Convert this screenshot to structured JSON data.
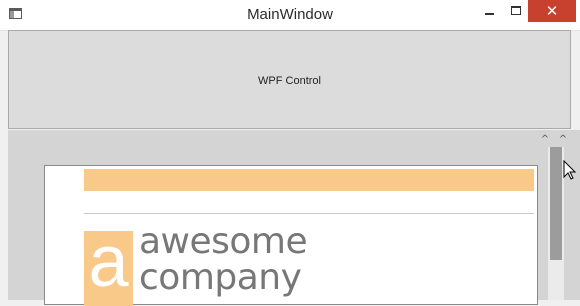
{
  "window": {
    "title": "MainWindow",
    "close_glyph": "✕"
  },
  "wpf_panel": {
    "label": "WPF Control"
  },
  "document": {
    "logo_letter": "a",
    "logo_line1": "awesome",
    "logo_line2": "company",
    "brand_color": "#f9c98a"
  },
  "scrollbar": {
    "up_glyph": "^"
  },
  "colors": {
    "close_button": "#c8412f",
    "panel_bg": "#dcdcdc",
    "viewer_bg": "#d4d4d4",
    "logo_text": "#777777"
  }
}
